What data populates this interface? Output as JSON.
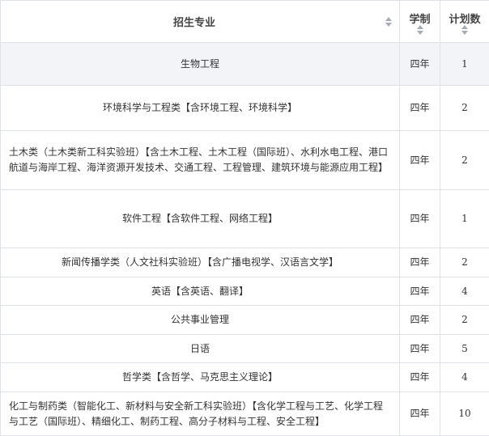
{
  "table": {
    "headers": {
      "major": "招生专业",
      "duration": "学制",
      "plan": "计划数"
    },
    "sort_icon": "sort-arrows-icon",
    "rows": [
      {
        "major": "生物工程",
        "duration": "四年",
        "plan": "1"
      },
      {
        "major": "环境科学与工程类【含环境工程、环境科学】",
        "duration": "四年",
        "plan": "2"
      },
      {
        "major": "土木类（土木类新工科实验班）【含土木工程、土木工程（国际班）、水利水电工程、港口航道与海岸工程、海洋资源开发技术、交通工程、工程管理、建筑环境与能源应用工程】",
        "duration": "四年",
        "plan": "2"
      },
      {
        "major": "软件工程【含软件工程、网络工程】",
        "duration": "四年",
        "plan": "1"
      },
      {
        "major": "新闻传播学类（人文社科实验班）【含广播电视学、汉语言文学】",
        "duration": "四年",
        "plan": "2"
      },
      {
        "major": "英语【含英语、翻译】",
        "duration": "四年",
        "plan": "4"
      },
      {
        "major": "公共事业管理",
        "duration": "四年",
        "plan": "2"
      },
      {
        "major": "日语",
        "duration": "四年",
        "plan": "5"
      },
      {
        "major": "哲学类【含哲学、马克思主义理论】",
        "duration": "四年",
        "plan": "4"
      },
      {
        "major": "化工与制药类（智能化工、新材料与安全新工科实验班）【含化学工程与工艺、化学工程与工艺（国际班）、精细化工、制药工程、高分子材料与工程、安全工程】",
        "duration": "四年",
        "plan": "10"
      }
    ]
  }
}
